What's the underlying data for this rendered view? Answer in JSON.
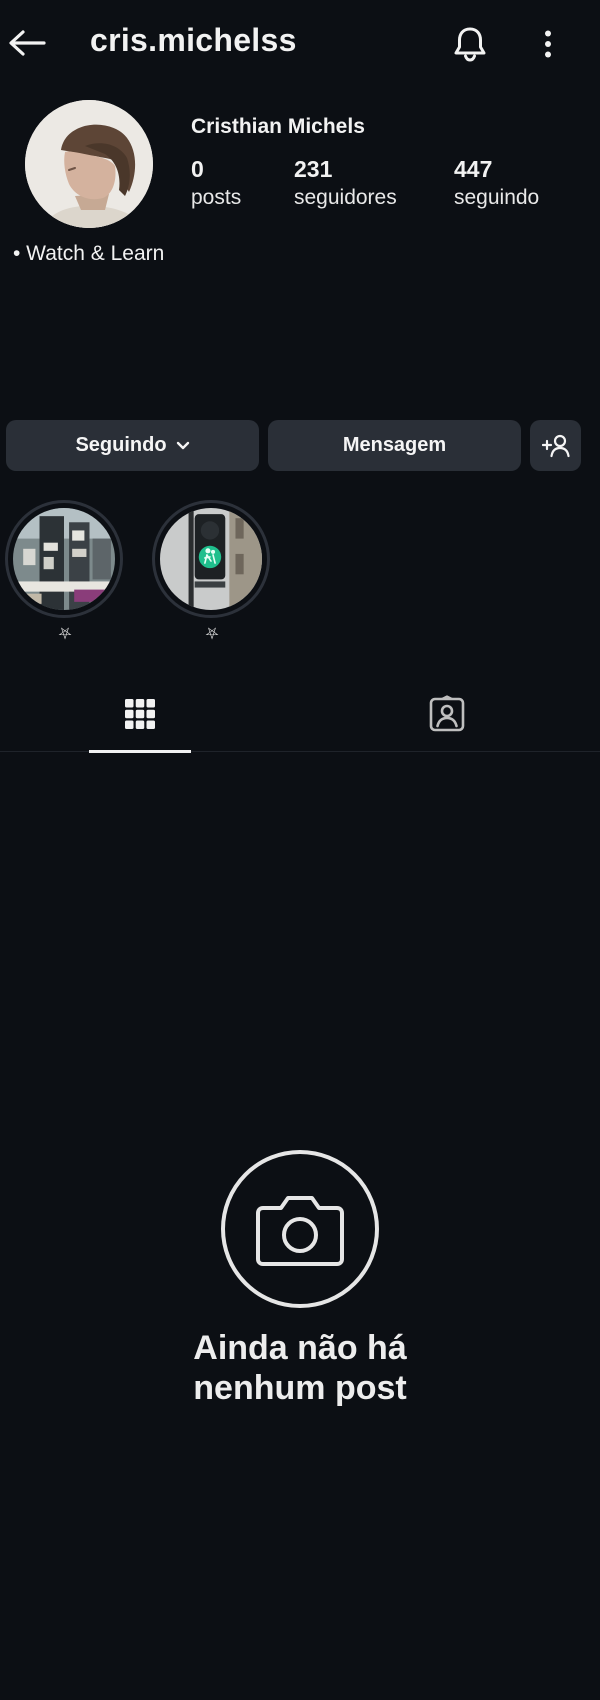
{
  "header": {
    "username": "cris.michelss",
    "back_icon": "arrow-left-icon",
    "notifications_icon": "bell-icon",
    "more_icon": "more-vertical-icon"
  },
  "profile": {
    "display_name": "Cristhian Michels",
    "bio": "• Watch & Learn",
    "stats": {
      "posts": {
        "value": "0",
        "label": "posts"
      },
      "followers": {
        "value": "231",
        "label": "seguidores"
      },
      "following": {
        "value": "447",
        "label": "seguindo"
      }
    }
  },
  "actions": {
    "following_label": "Seguindo",
    "message_label": "Mensagem",
    "add_person_icon": "add-person-icon"
  },
  "highlights": [
    {
      "label": "⛧"
    },
    {
      "label": "⛧"
    }
  ],
  "tabs": {
    "grid_icon": "grid-icon",
    "tagged_icon": "tagged-person-icon",
    "active": "grid"
  },
  "empty_state": {
    "icon": "camera-icon",
    "line1": "Ainda não há",
    "line2": "nenhum post"
  },
  "colors": {
    "background": "#0c0f14",
    "button": "#2a2f37",
    "text": "#f2f2f2"
  }
}
